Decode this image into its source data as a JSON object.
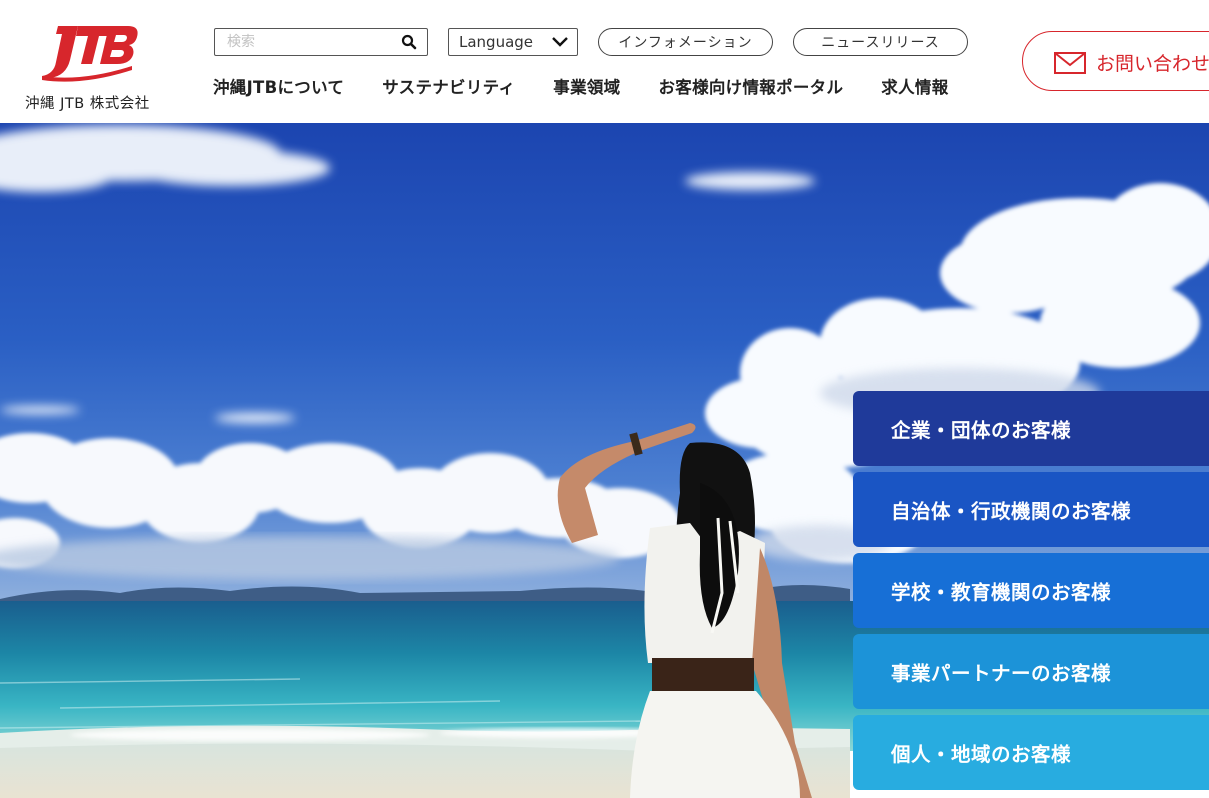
{
  "header": {
    "logo_text": "JTB",
    "company_name": "沖縄 JTB 株式会社",
    "search": {
      "placeholder": "検索",
      "value": ""
    },
    "language": {
      "selected": "Language"
    },
    "pills": {
      "information": "インフォメーション",
      "news": "ニュースリリース"
    },
    "nav": [
      {
        "label": "沖縄JTBについて"
      },
      {
        "label": "サステナビリティ"
      },
      {
        "label": "事業領域"
      },
      {
        "label": "お客様向け情報ポータル"
      },
      {
        "label": "求人情報"
      }
    ],
    "contact": {
      "label": "お問い合わせ"
    }
  },
  "hero": {
    "audience_buttons": [
      {
        "label": "企業・団体のお客様"
      },
      {
        "label": "自治体・行政機関のお客様"
      },
      {
        "label": "学校・教育機関のお客様"
      },
      {
        "label": "事業パートナーのお客様"
      },
      {
        "label": "個人・地域のお客様"
      }
    ]
  },
  "colors": {
    "brand_red": "#d7262c",
    "audience_1": "#1f3a9a",
    "audience_2": "#1a55c4",
    "audience_3": "#176fd6",
    "audience_4": "#1c93d8",
    "audience_5": "#28ace0"
  },
  "icons": {
    "search": "search-icon",
    "language_dropdown": "chevron-down-icon",
    "contact": "mail-icon"
  }
}
